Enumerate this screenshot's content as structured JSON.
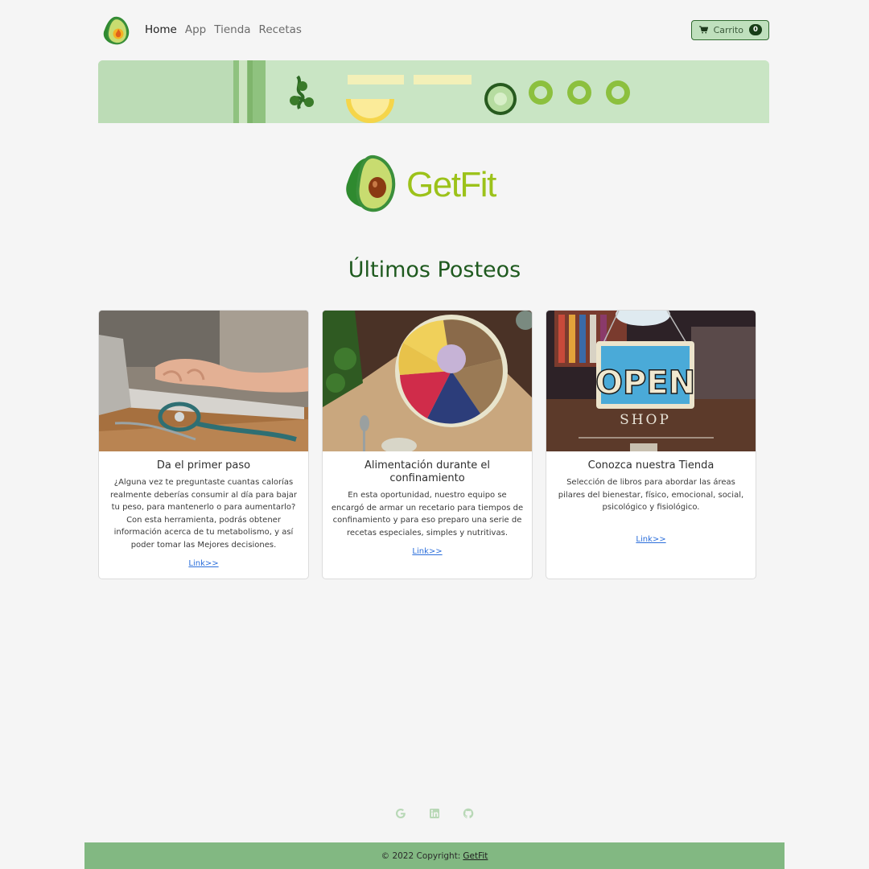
{
  "nav": {
    "logo_icon": "avocado-logo-icon",
    "links": [
      "Home",
      "App",
      "Tienda",
      "Recetas"
    ],
    "active_link": "Home",
    "cart_label": "Carrito",
    "cart_count": "0",
    "cart_icon": "shopping-cart-icon"
  },
  "brand": {
    "name": "GetFit",
    "logo_icon": "avocado-logo-icon",
    "color": "#9cc21a"
  },
  "section": {
    "title": "Últimos Posteos"
  },
  "cards": [
    {
      "image": "laptop-stethoscope-photo",
      "title": "Da el primer paso",
      "text": "¿Alguna vez te preguntaste cuantas calorías realmente deberías consumir al día para bajar tu peso, para mantenerlo o para aumentarlo? Con esta herramienta, podrás obtener información acerca de tu metabolismo, y así poder tomar las Mejores decisiones.",
      "link": "Link>>"
    },
    {
      "image": "healthy-bowl-photo",
      "title": "Alimentación durante el confinamiento",
      "text": "En esta oportunidad, nuestro equipo se encargó de armar un recetario para tiempos de confinamiento y para eso preparo una serie de recetas especiales, simples y nutritivas.",
      "link": "Link>>"
    },
    {
      "image": "open-shop-sign-photo",
      "title": "Conozca nuestra Tienda",
      "text": "Selección de libros para abordar las áreas pilares del bienestar, físico, emocional, social, psicológico y fisiológico.",
      "link": "Link>>"
    }
  ],
  "socials": [
    "google-icon",
    "linkedin-icon",
    "github-icon"
  ],
  "footer": {
    "copyright": "© 2022 Copyright:",
    "brand_link": "GetFit"
  },
  "colors": {
    "background": "#f5f5f5",
    "accent_green": "#1f5a1f",
    "footer_green": "#82b882",
    "cart_bg": "#bfe0bd",
    "link_blue": "#2c6fdb"
  }
}
